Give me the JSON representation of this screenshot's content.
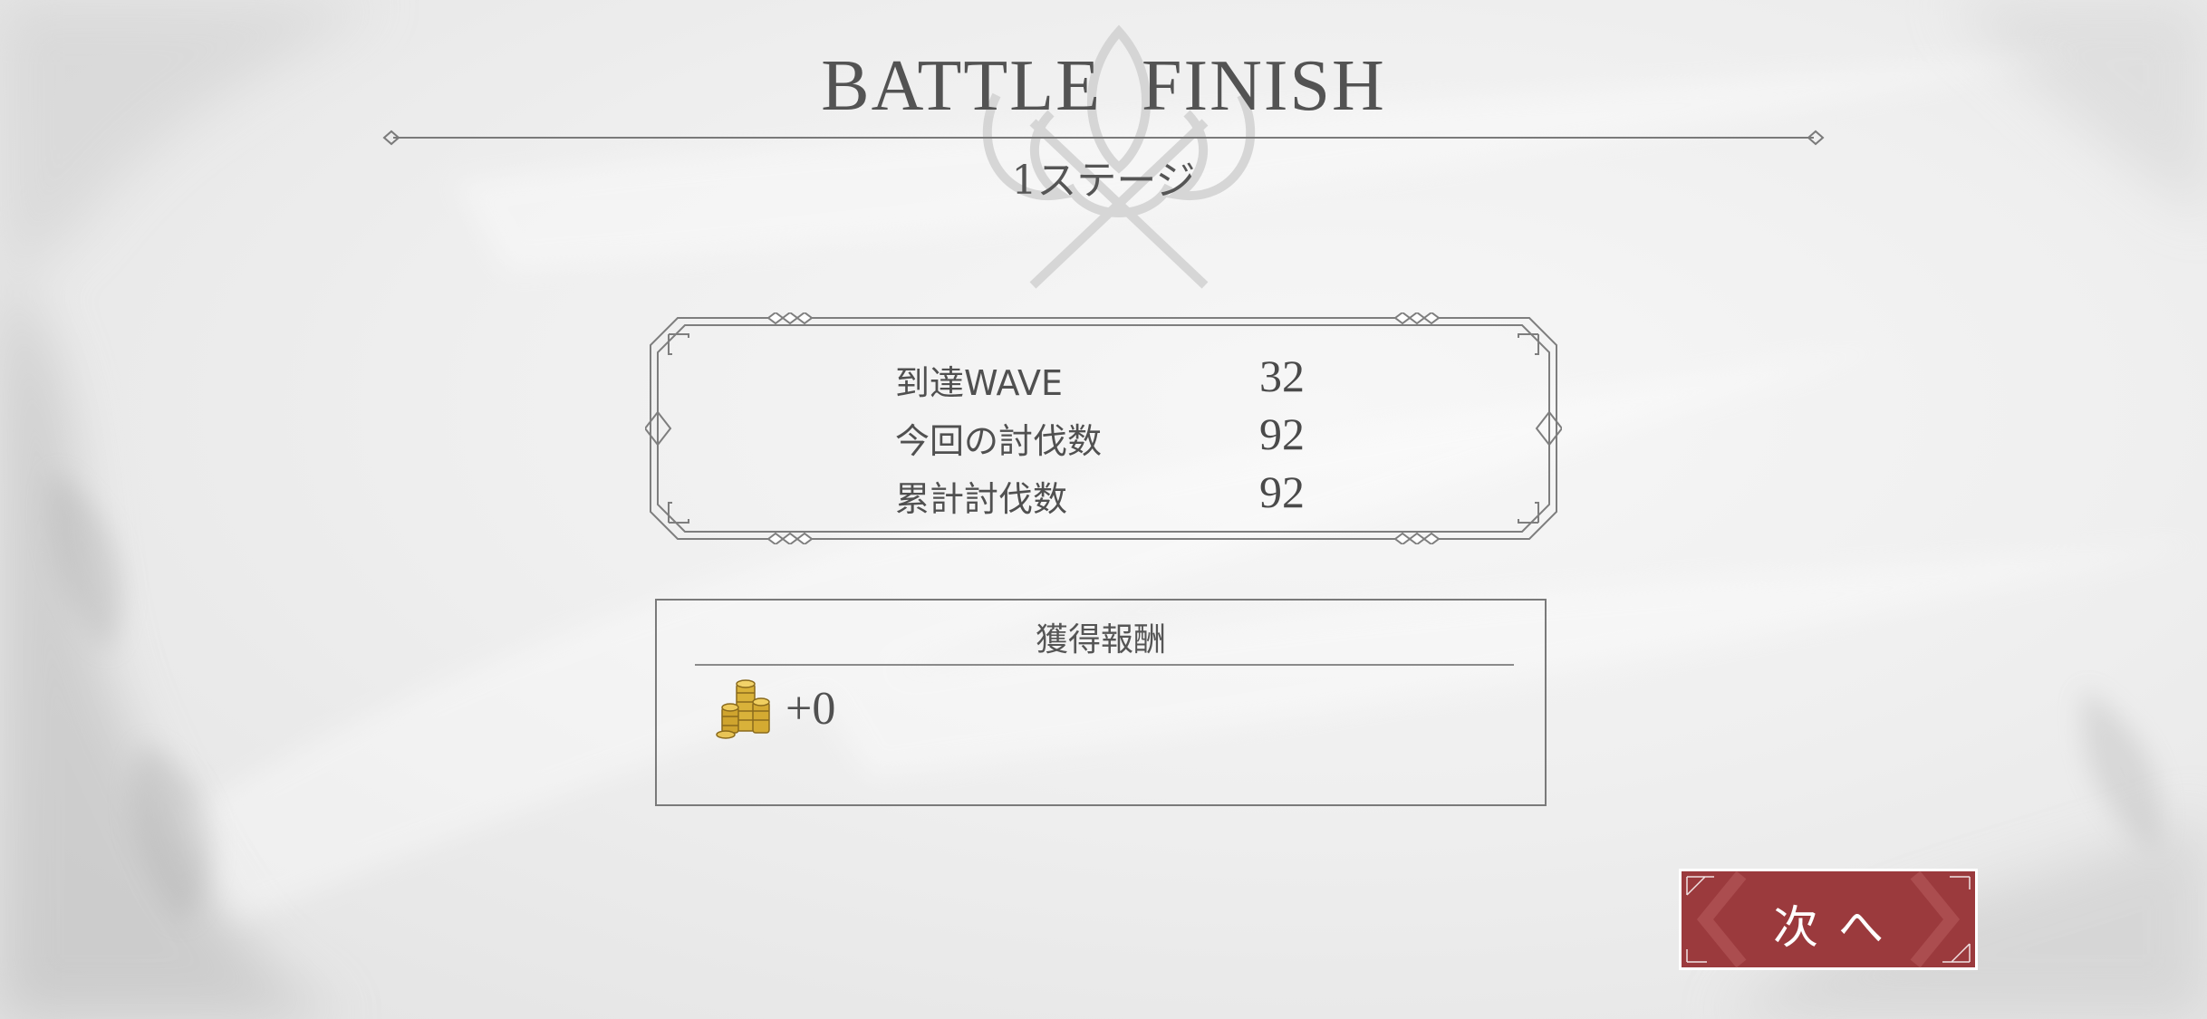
{
  "screen": {
    "title": "BATTLE  FINISH",
    "subtitle": "1ステージ"
  },
  "stats": [
    {
      "label": "到達WAVE",
      "value": "32"
    },
    {
      "label": "今回の討伐数",
      "value": "92"
    },
    {
      "label": "累計討伐数",
      "value": "92"
    }
  ],
  "rewards": {
    "title": "獲得報酬",
    "items": [
      {
        "icon": "gold-coins-icon",
        "amount": "+0"
      }
    ]
  },
  "next_button": {
    "label": "次へ"
  },
  "colors": {
    "button_red": "#9b3a3d",
    "text_gray": "#4a4a4a",
    "background": "#eeeeee"
  }
}
